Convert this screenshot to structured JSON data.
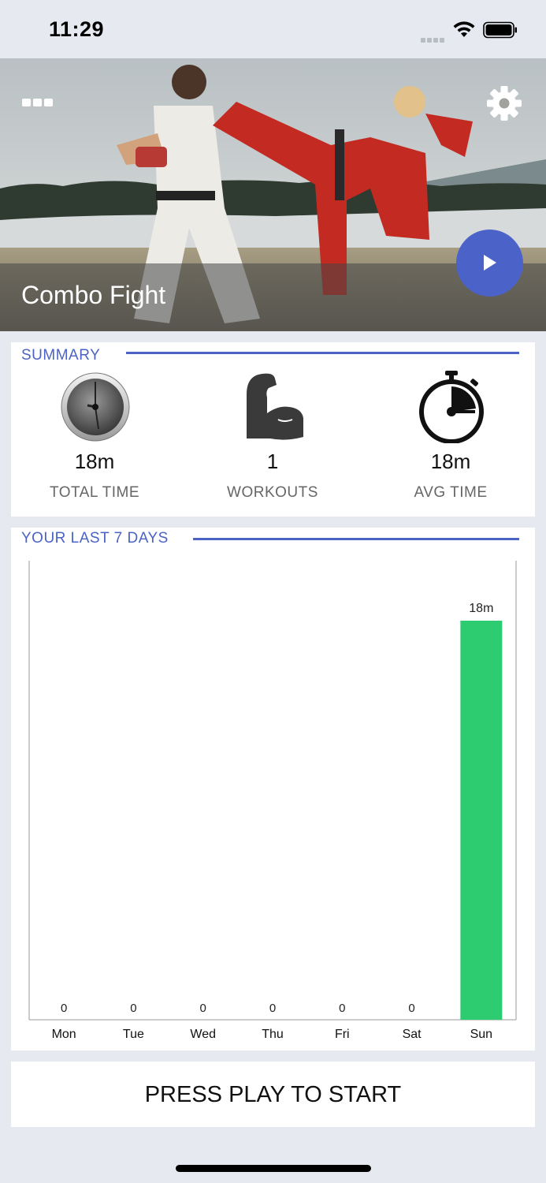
{
  "status_bar": {
    "time": "11:29"
  },
  "hero": {
    "title": "Combo Fight",
    "menu_icon": "more-dots-icon",
    "settings_icon": "gear-icon",
    "play_icon": "play-icon"
  },
  "summary": {
    "title": "SUMMARY",
    "stats": [
      {
        "icon": "clock-icon",
        "value": "18m",
        "label": "TOTAL TIME"
      },
      {
        "icon": "flexed-arm-icon",
        "value": "1",
        "label": "WORKOUTS"
      },
      {
        "icon": "stopwatch-icon",
        "value": "18m",
        "label": "AVG TIME"
      }
    ]
  },
  "week": {
    "title": "YOUR LAST 7 DAYS"
  },
  "chart_data": {
    "type": "bar",
    "categories": [
      "Mon",
      "Tue",
      "Wed",
      "Thu",
      "Fri",
      "Sat",
      "Sun"
    ],
    "values": [
      0,
      0,
      0,
      0,
      0,
      0,
      18
    ],
    "data_labels": [
      "0",
      "0",
      "0",
      "0",
      "0",
      "0",
      "18m"
    ],
    "bar_color": "#2ecc71",
    "grid": false
  },
  "start": {
    "label": "PRESS PLAY TO START"
  },
  "colors": {
    "accent": "#4a63c4",
    "play_button": "#4b63c8",
    "bar": "#2ecc71",
    "background": "#e6e9ef"
  }
}
